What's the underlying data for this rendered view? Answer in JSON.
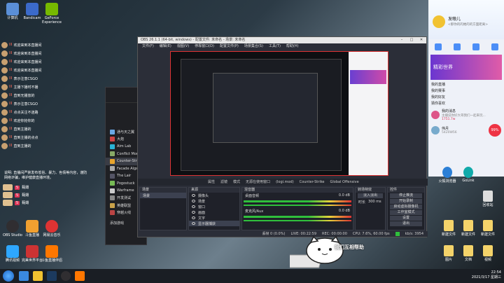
{
  "desktop_icons_left": [
    {
      "label": "计算机",
      "color": "#5a8fd8"
    },
    {
      "label": "Bandicam",
      "color": "#3b6ac9"
    },
    {
      "label": "GeForce Experience",
      "color": "#76b900"
    }
  ],
  "desktop_icons_bottom": [
    {
      "label": "OBS Studio",
      "color": "#302e31"
    },
    {
      "label": "斗鱼直播",
      "color": "#f0a030"
    },
    {
      "label": "网易云音乐",
      "color": "#d33"
    },
    {
      "label": "腾讯视频",
      "color": "#2ea7ff"
    },
    {
      "label": "完美世界平台",
      "color": "#c33"
    },
    {
      "label": "斗鱼直播伴侣",
      "color": "#ff7700"
    }
  ],
  "chat_messages": [
    {
      "user": "欢迎来到本直播间",
      "badge": "III"
    },
    {
      "user": "欢迎来到本直播间",
      "badge": "III"
    },
    {
      "user": "欢迎来到本直播间",
      "badge": "III"
    },
    {
      "user": "欢迎来到本直播间",
      "badge": "III"
    },
    {
      "user": "表示注意CSGO",
      "badge": "III"
    },
    {
      "user": "主播下播时不播",
      "badge": "III"
    },
    {
      "user": "直到无播放的",
      "badge": "III"
    },
    {
      "user": "表示注意CSGO",
      "badge": "III"
    },
    {
      "user": "点点关注不迷路",
      "badge": "III"
    },
    {
      "user": "欢迎你抢你的",
      "badge": "III"
    },
    {
      "user": "直到主播的",
      "badge": "III"
    },
    {
      "user": "直到主播的点点",
      "badge": "III"
    },
    {
      "user": "直到主播的",
      "badge": "III"
    }
  ],
  "chat_notice": "说明: 直播间严禁发布低俗、暴力、色情等内容，谨防网络诈骗，维护健康直播环境。",
  "bottom_badges": [
    {
      "name": "甄嬛",
      "level": "5"
    },
    {
      "name": "甄嬛",
      "level": "5"
    },
    {
      "name": "甄嬛",
      "level": "5"
    }
  ],
  "launcher": {
    "items": [
      {
        "label": "通与天之翼",
        "color": "#6aa8e6"
      },
      {
        "label": "大炮",
        "color": "#c44"
      },
      {
        "label": "Aim Lab",
        "color": "#2ab3d6"
      },
      {
        "label": "Conflict Mode",
        "color": "#8a6"
      },
      {
        "label": "Counter-Strike",
        "color": "#e8a42c"
      },
      {
        "label": "Facade Algs",
        "color": "#aaa"
      },
      {
        "label": "The Lair",
        "color": "#556"
      },
      {
        "label": "Pogostuck",
        "color": "#7b5"
      },
      {
        "label": "Warframe",
        "color": "#ccc"
      },
      {
        "label": "开发测试",
        "color": "#888"
      },
      {
        "label": "英雄联盟",
        "color": "#c9a24a"
      },
      {
        "label": "穿越火线",
        "color": "#b44"
      }
    ],
    "add_game": "添加游戏"
  },
  "obs": {
    "title": "OBS 26.1.1 (64-bit, windows) - 配置文件: 未命名 - 场景: 未命名",
    "menu": [
      "文件(F)",
      "编辑(E)",
      "视图(V)",
      "停靠窗口(D)",
      "配置文件(P)",
      "场景集合(S)",
      "工具(T)",
      "帮助(H)"
    ],
    "scene_bar": [
      "属性",
      "滤镜",
      "模式",
      "无源在使用窗口",
      "(logi.mod)",
      "Counter-Strike",
      "Global Offensive"
    ],
    "docks": {
      "scenes": "场景",
      "sources": "来源",
      "mixer": "混音器",
      "transitions": "转场特效",
      "controls": "控件"
    },
    "scene_items": [
      "场景"
    ],
    "source_items": [
      "摄像头",
      "场景",
      "窗口",
      "画面",
      "文字",
      "显示器捕获"
    ],
    "mixer_items": [
      {
        "label": "桌面音频",
        "db": "0.0 dB"
      },
      {
        "label": "麦克风/Aux",
        "db": "0.0 dB"
      }
    ],
    "transition": {
      "label": "淡入淡出",
      "duration_label": "时长",
      "duration": "300 ms"
    },
    "controls": [
      "停止推流",
      "开始录制",
      "启动虚拟摄像机",
      "工作室模式",
      "设置",
      "退出"
    ],
    "status": [
      "丢帧 0 (0.0%)",
      "LIVE: 00:22:59",
      "REC: 00:00:00",
      "CPU: 7.6%, 60.00 fps",
      "kb/s: 3954"
    ]
  },
  "qq": {
    "name": "发嗷儿",
    "signature": "<那你的的她的的方面距离>",
    "promo": "精彩世界",
    "list": [
      "我的直播",
      "我的赛事",
      "我的好友",
      "猜你喜欢"
    ],
    "chats": [
      {
        "name": "我的消息",
        "sub": "主播说你好大哥我们一起来玩...",
        "count": "1751.7w"
      },
      {
        "name": "伟月",
        "sub": "5420W56",
        "count": "99%"
      }
    ]
  },
  "desktop_icons_right": [
    {
      "label": "火狐浏览器"
    },
    {
      "label": "GoLink"
    },
    {
      "label": "回收站"
    },
    {
      "label": "新建文件"
    },
    {
      "label": "新建文件"
    },
    {
      "label": "新建文件"
    },
    {
      "label": "图片"
    },
    {
      "label": "文档"
    },
    {
      "label": "视频"
    }
  ],
  "tray": {
    "time": "22:54",
    "date": "2021/3/17 星期三"
  },
  "sticker_text": "我们互相帮助"
}
